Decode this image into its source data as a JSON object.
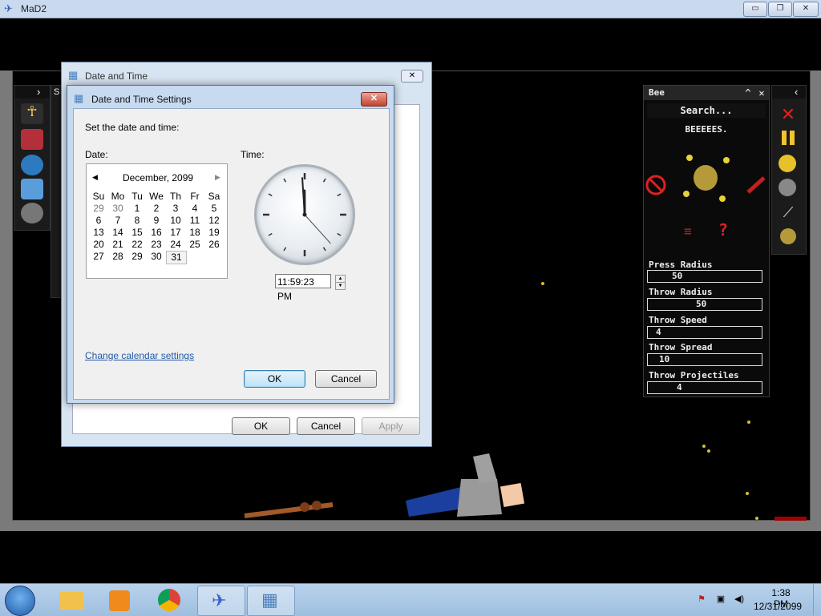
{
  "window": {
    "title": "MaD2",
    "minimize": "▭",
    "restore": "❐",
    "close": "✕"
  },
  "left_toolbar": {
    "expand_icon": "›",
    "tab_letter": "S"
  },
  "bee_panel": {
    "title": "Bee",
    "collapse_icon": "^",
    "close_icon": "✕",
    "search_label": "Search...",
    "description": "BEEEEES.",
    "properties": [
      {
        "label": "Press Radius",
        "value": "50"
      },
      {
        "label": "Throw Radius",
        "value": "50"
      },
      {
        "label": "Throw Speed",
        "value": "4"
      },
      {
        "label": "Throw Spread",
        "value": "10"
      },
      {
        "label": "Throw Projectiles",
        "value": "4"
      }
    ]
  },
  "right_toolbar": {
    "collapse_icon": "‹"
  },
  "date_time_dialog": {
    "title": "Date and Time",
    "close": "✕",
    "ok": "OK",
    "cancel": "Cancel",
    "apply": "Apply"
  },
  "settings_dialog": {
    "title": "Date and Time Settings",
    "close": "✕",
    "instruction": "Set the date and time:",
    "date_label": "Date:",
    "time_label": "Time:",
    "month_year": "December, 2099",
    "prev_icon": "◀",
    "next_icon": "▶",
    "day_names": [
      "Su",
      "Mo",
      "Tu",
      "We",
      "Th",
      "Fr",
      "Sa"
    ],
    "weeks": [
      [
        "29",
        "30",
        "1",
        "2",
        "3",
        "4",
        "5"
      ],
      [
        "6",
        "7",
        "8",
        "9",
        "10",
        "11",
        "12"
      ],
      [
        "13",
        "14",
        "15",
        "16",
        "17",
        "18",
        "19"
      ],
      [
        "20",
        "21",
        "22",
        "23",
        "24",
        "25",
        "26"
      ],
      [
        "27",
        "28",
        "29",
        "30",
        "31",
        "",
        ""
      ]
    ],
    "selected_day": "31",
    "time_value": "11:59:23 PM",
    "clock": {
      "hours": 11,
      "minutes": 59,
      "seconds": 23
    },
    "calendar_link": "Change calendar settings",
    "ok": "OK",
    "cancel": "Cancel"
  },
  "taskbar": {
    "time": "1:38 PM",
    "date": "12/31/2099"
  }
}
